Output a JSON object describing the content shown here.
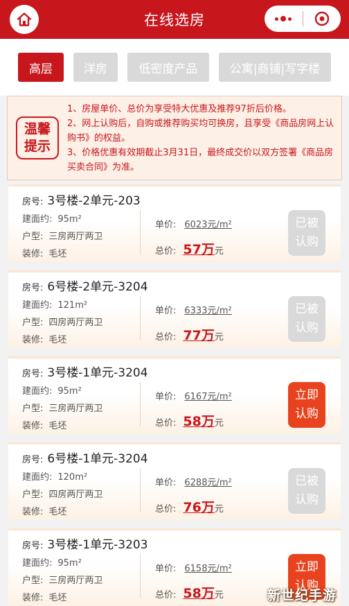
{
  "header": {
    "title": "在线选房"
  },
  "tabs": [
    {
      "label": "高层",
      "active": true
    },
    {
      "label": "洋房",
      "active": false
    },
    {
      "label": "低密度产品",
      "active": false
    },
    {
      "label": "公寓|商铺|写字楼",
      "active": false
    }
  ],
  "notice": {
    "badge_line1": "温馨",
    "badge_line2": "提示",
    "lines": [
      "1、房屋单价、总价为享受特大优惠及推荐97折后价格。",
      "2、网上认购后，自购或推荐购买均可换房，且享受《商品房网上认购书》的权益。",
      "3、价格优惠有效期截止3月31日，最终成交价以双方签署《商品房买卖合同》为准。"
    ]
  },
  "labels": {
    "room": "房号:",
    "area": "建面约:",
    "layout": "户型:",
    "decoration": "装修:",
    "unit_price": "单价:",
    "total_price": "总价:",
    "unit_price_suffix": "元/m²",
    "total_suffix": "元"
  },
  "listings": [
    {
      "room": "3号楼-2单元-203",
      "area": "95m²",
      "layout": "三房两厅两卫",
      "decoration": "毛坯",
      "unit_price": "6023",
      "total": "57万",
      "btn_line1": "已被",
      "btn_line2": "认购",
      "available": false
    },
    {
      "room": "6号楼-2单元-3204",
      "area": "121m²",
      "layout": "四房两厅两卫",
      "decoration": "毛坯",
      "unit_price": "6333",
      "total": "77万",
      "btn_line1": "已被",
      "btn_line2": "认购",
      "available": false
    },
    {
      "room": "3号楼-1单元-3204",
      "area": "95m²",
      "layout": "三房两厅两卫",
      "decoration": "毛坯",
      "unit_price": "6167",
      "total": "58万",
      "btn_line1": "立即",
      "btn_line2": "认购",
      "available": true
    },
    {
      "room": "6号楼-1单元-3204",
      "area": "120m²",
      "layout": "四房两厅两卫",
      "decoration": "毛坯",
      "unit_price": "6288",
      "total": "76万",
      "btn_line1": "已被",
      "btn_line2": "认购",
      "available": false
    },
    {
      "room": "3号楼-1单元-3203",
      "area": "95m²",
      "layout": "三房两厅两卫",
      "decoration": "毛坯",
      "unit_price": "6158",
      "total": "58万",
      "btn_line1": "立即",
      "btn_line2": "认购",
      "available": true
    }
  ],
  "watermark": "新世纪手游",
  "colors": {
    "brand": "#c8161d",
    "buy_button": "#e8431e",
    "sold_button": "#d9d9d9"
  }
}
